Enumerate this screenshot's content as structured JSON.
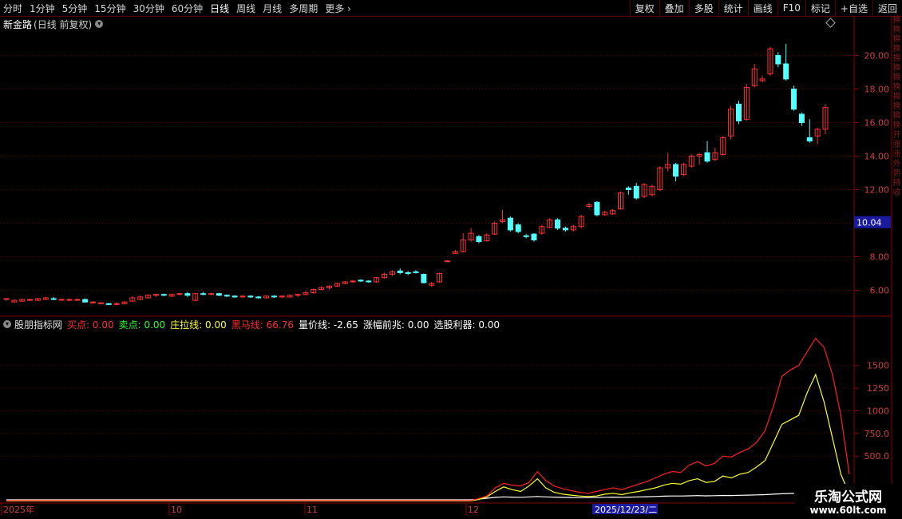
{
  "toolbar": {
    "periods": [
      "分时",
      "1分钟",
      "5分钟",
      "15分钟",
      "30分钟",
      "60分钟",
      "日线",
      "周线",
      "月线",
      "多周期",
      "更多"
    ],
    "active_period": "日线",
    "right_tools": [
      "复权",
      "叠加",
      "多股",
      "统计",
      "画线",
      "F10",
      "标记",
      "+自选",
      "返回"
    ]
  },
  "stock": {
    "name": "新金路",
    "mode": "(日线 前复权)"
  },
  "price_axis": {
    "ticks": [
      "20.00",
      "18.00",
      "16.00",
      "14.00",
      "12.00",
      "10.00",
      "8.00",
      "6.00"
    ],
    "current_price": "10.04"
  },
  "indicator": {
    "name": "股朋指标网",
    "items": [
      {
        "label": "买点:",
        "value": "0.00",
        "color": "#ff3030"
      },
      {
        "label": "卖点:",
        "value": "0.00",
        "color": "#30ff30"
      },
      {
        "label": "庄拉线:",
        "value": "0.00",
        "color": "#ffff40"
      },
      {
        "label": "黑马线:",
        "value": "66.76",
        "color": "#ff3030"
      },
      {
        "label": "量价线:",
        "value": "-2.65",
        "color": "#ffffff"
      },
      {
        "label": "涨幅前兆:",
        "value": "0.00",
        "color": "#ffffff"
      },
      {
        "label": "选股利器:",
        "value": "0.00",
        "color": "#ffffff"
      }
    ],
    "ticks": [
      "1500",
      "1250",
      "1000",
      "750.0",
      "500.0"
    ]
  },
  "date_axis": {
    "labels": [
      "2025年",
      "10",
      "11",
      "12"
    ],
    "cursor_date": "2025/12/23/二"
  },
  "watermark": {
    "line1": "乐淘公式网",
    "line2": "www.60lt.com"
  },
  "right_strip": [
    "换",
    "换",
    "换",
    "换",
    "换",
    "换",
    "换",
    "换",
    "换",
    "换",
    "换",
    "换",
    "开",
    "涨",
    "涨",
    "外",
    "势",
    "持",
    "收"
  ],
  "chart_data": {
    "type": "candlestick",
    "ylim": [
      4.5,
      21.5
    ],
    "candles": [
      [
        5.45,
        5.5,
        5.4,
        5.35
      ],
      [
        5.3,
        5.4,
        5.45,
        5.25
      ],
      [
        5.35,
        5.45,
        5.5,
        5.3
      ],
      [
        5.4,
        5.45,
        5.5,
        5.35
      ],
      [
        5.4,
        5.5,
        5.55,
        5.35
      ],
      [
        5.45,
        5.55,
        5.6,
        5.4
      ],
      [
        5.5,
        5.45,
        5.6,
        5.4
      ],
      [
        5.45,
        5.45,
        5.5,
        5.4
      ],
      [
        5.4,
        5.45,
        5.5,
        5.35
      ],
      [
        5.45,
        5.45,
        5.5,
        5.35
      ],
      [
        5.45,
        5.3,
        5.5,
        5.25
      ],
      [
        5.3,
        5.3,
        5.35,
        5.2
      ],
      [
        5.25,
        5.25,
        5.3,
        5.15
      ],
      [
        5.2,
        5.15,
        5.25,
        5.1
      ],
      [
        5.15,
        5.2,
        5.3,
        5.1
      ],
      [
        5.2,
        5.3,
        5.35,
        5.15
      ],
      [
        5.35,
        5.55,
        5.65,
        5.3
      ],
      [
        5.45,
        5.6,
        5.7,
        5.4
      ],
      [
        5.55,
        5.7,
        5.75,
        5.5
      ],
      [
        5.7,
        5.75,
        5.8,
        5.6
      ],
      [
        5.75,
        5.7,
        5.8,
        5.65
      ],
      [
        5.65,
        5.75,
        5.8,
        5.6
      ],
      [
        5.75,
        5.8,
        5.85,
        5.7
      ],
      [
        5.8,
        5.7,
        5.9,
        5.6
      ],
      [
        5.4,
        5.8,
        5.85,
        5.35
      ],
      [
        5.8,
        5.75,
        5.9,
        5.7
      ],
      [
        5.75,
        5.8,
        5.85,
        5.7
      ],
      [
        5.8,
        5.7,
        5.85,
        5.65
      ],
      [
        5.7,
        5.65,
        5.75,
        5.6
      ],
      [
        5.65,
        5.6,
        5.7,
        5.55
      ],
      [
        5.6,
        5.65,
        5.7,
        5.55
      ],
      [
        5.65,
        5.6,
        5.7,
        5.55
      ],
      [
        5.6,
        5.55,
        5.65,
        5.5
      ],
      [
        5.55,
        5.65,
        5.7,
        5.5
      ],
      [
        5.65,
        5.6,
        5.7,
        5.55
      ],
      [
        5.6,
        5.65,
        5.7,
        5.55
      ],
      [
        5.6,
        5.7,
        5.75,
        5.55
      ],
      [
        5.7,
        5.75,
        5.8,
        5.6
      ],
      [
        5.75,
        5.85,
        5.95,
        5.7
      ],
      [
        5.85,
        6.05,
        6.1,
        5.8
      ],
      [
        6.05,
        6.15,
        6.25,
        6.0
      ],
      [
        6.15,
        6.25,
        6.3,
        6.05
      ],
      [
        6.25,
        6.4,
        6.45,
        6.2
      ],
      [
        6.4,
        6.5,
        6.55,
        6.35
      ],
      [
        6.5,
        6.55,
        6.6,
        6.45
      ],
      [
        6.6,
        6.55,
        6.65,
        6.5
      ],
      [
        6.55,
        6.5,
        6.6,
        6.45
      ],
      [
        6.5,
        6.75,
        6.8,
        6.45
      ],
      [
        6.75,
        6.95,
        7.05,
        6.7
      ],
      [
        6.95,
        7.1,
        7.2,
        6.85
      ],
      [
        7.15,
        7.05,
        7.3,
        6.95
      ],
      [
        7.05,
        7.0,
        7.15,
        6.9
      ],
      [
        7.1,
        7.05,
        7.2,
        7.0
      ],
      [
        6.95,
        6.45,
        7.0,
        6.4
      ],
      [
        6.3,
        6.4,
        6.5,
        6.2
      ],
      [
        6.5,
        7.0,
        7.05,
        6.45
      ],
      [
        7.75,
        7.75,
        7.8,
        7.7
      ],
      [
        8.2,
        8.3,
        8.4,
        8.2
      ],
      [
        8.3,
        9.0,
        9.4,
        8.25
      ],
      [
        9.0,
        9.4,
        9.7,
        8.9
      ],
      [
        9.2,
        8.9,
        9.3,
        8.8
      ],
      [
        8.95,
        9.3,
        9.4,
        8.9
      ],
      [
        9.35,
        10.0,
        10.1,
        9.3
      ],
      [
        10.1,
        10.2,
        10.8,
        10.0
      ],
      [
        10.3,
        9.6,
        10.4,
        9.5
      ],
      [
        9.9,
        9.5,
        10.0,
        9.4
      ],
      [
        9.25,
        9.2,
        9.35,
        9.1
      ],
      [
        9.35,
        9.0,
        9.4,
        8.9
      ],
      [
        9.4,
        9.8,
        9.9,
        9.3
      ],
      [
        9.75,
        10.2,
        10.3,
        9.7
      ],
      [
        10.2,
        9.7,
        10.3,
        9.6
      ],
      [
        9.7,
        9.6,
        9.8,
        9.5
      ],
      [
        9.6,
        9.8,
        9.9,
        9.5
      ],
      [
        9.8,
        10.4,
        10.5,
        9.7
      ],
      [
        11.0,
        11.1,
        11.2,
        10.9
      ],
      [
        11.25,
        10.5,
        11.3,
        10.4
      ],
      [
        10.5,
        10.65,
        10.75,
        10.45
      ],
      [
        10.55,
        10.75,
        10.85,
        10.5
      ],
      [
        10.85,
        11.8,
        11.9,
        10.8
      ],
      [
        12.1,
        12.0,
        12.2,
        11.7
      ],
      [
        12.2,
        11.5,
        12.4,
        11.4
      ],
      [
        11.6,
        12.3,
        12.4,
        11.5
      ],
      [
        11.7,
        12.2,
        12.3,
        11.6
      ],
      [
        12.0,
        13.3,
        13.4,
        11.9
      ],
      [
        13.3,
        13.5,
        14.2,
        13.1
      ],
      [
        13.5,
        12.8,
        13.6,
        12.5
      ],
      [
        12.9,
        13.5,
        13.6,
        12.8
      ],
      [
        13.4,
        14.0,
        14.1,
        13.3
      ],
      [
        14.0,
        14.1,
        14.2,
        13.5
      ],
      [
        14.2,
        13.7,
        14.9,
        13.6
      ],
      [
        13.8,
        14.2,
        14.5,
        13.7
      ],
      [
        14.1,
        15.1,
        15.2,
        14.0
      ],
      [
        15.2,
        16.8,
        17.0,
        15.0
      ],
      [
        17.1,
        16.1,
        17.3,
        15.9
      ],
      [
        16.2,
        18.1,
        18.3,
        16.1
      ],
      [
        18.2,
        19.2,
        19.5,
        18.1
      ],
      [
        18.5,
        18.6,
        18.8,
        18.4
      ],
      [
        18.9,
        20.4,
        20.5,
        18.8
      ],
      [
        20.0,
        19.5,
        20.2,
        19.3
      ],
      [
        19.5,
        18.6,
        20.7,
        18.5
      ],
      [
        18.0,
        16.8,
        18.2,
        16.7
      ],
      [
        16.5,
        16.0,
        16.6,
        15.8
      ],
      [
        15.1,
        14.9,
        16.2,
        14.8
      ],
      [
        15.2,
        15.6,
        15.7,
        14.7
      ],
      [
        15.6,
        16.9,
        17.1,
        15.3
      ]
    ],
    "indicator_series": {
      "ylim": [
        0,
        1850
      ],
      "red": [
        10,
        10,
        10,
        10,
        10,
        10,
        10,
        10,
        10,
        10,
        10,
        10,
        10,
        10,
        10,
        10,
        10,
        10,
        10,
        10,
        10,
        10,
        10,
        10,
        10,
        10,
        10,
        10,
        10,
        10,
        10,
        10,
        10,
        10,
        10,
        10,
        10,
        10,
        10,
        10,
        10,
        10,
        10,
        10,
        10,
        10,
        10,
        10,
        10,
        10,
        10,
        10,
        10,
        10,
        10,
        10,
        30,
        60,
        150,
        200,
        180,
        170,
        210,
        330,
        230,
        170,
        140,
        120,
        100,
        90,
        110,
        130,
        150,
        130,
        160,
        190,
        220,
        260,
        300,
        330,
        320,
        400,
        440,
        390,
        420,
        500,
        490,
        540,
        580,
        650,
        780,
        1050,
        1380,
        1450,
        1500,
        1650,
        1800,
        1700,
        1400,
        950,
        300
      ],
      "yellow": [
        5,
        5,
        5,
        5,
        5,
        5,
        5,
        5,
        5,
        5,
        5,
        5,
        5,
        5,
        5,
        5,
        5,
        5,
        5,
        5,
        5,
        5,
        5,
        5,
        5,
        5,
        5,
        5,
        5,
        5,
        5,
        5,
        5,
        5,
        5,
        5,
        5,
        5,
        5,
        5,
        5,
        5,
        5,
        5,
        5,
        5,
        5,
        5,
        5,
        5,
        5,
        5,
        5,
        5,
        5,
        5,
        20,
        50,
        110,
        160,
        130,
        110,
        170,
        250,
        150,
        100,
        80,
        70,
        60,
        55,
        60,
        80,
        90,
        75,
        95,
        110,
        130,
        150,
        180,
        200,
        190,
        230,
        250,
        210,
        220,
        280,
        260,
        300,
        320,
        380,
        450,
        650,
        850,
        900,
        950,
        1200,
        1400,
        1100,
        700,
        300,
        80
      ],
      "white": [
        18,
        18,
        18,
        18,
        18,
        18,
        18,
        18,
        18,
        18,
        18,
        18,
        18,
        18,
        18,
        18,
        18,
        18,
        18,
        18,
        18,
        18,
        18,
        18,
        18,
        18,
        18,
        18,
        18,
        18,
        18,
        18,
        18,
        18,
        18,
        18,
        18,
        18,
        18,
        18,
        18,
        18,
        18,
        18,
        18,
        18,
        18,
        18,
        18,
        18,
        18,
        18,
        18,
        18,
        18,
        18,
        25,
        35,
        45,
        50,
        48,
        46,
        50,
        55,
        50,
        48,
        45,
        43,
        42,
        42,
        44,
        46,
        48,
        46,
        48,
        50,
        52,
        55,
        58,
        60,
        60,
        62,
        64,
        62,
        63,
        66,
        65,
        68,
        70,
        72,
        75,
        80,
        85,
        88,
        90,
        92,
        95,
        92,
        88,
        80,
        60
      ]
    }
  }
}
